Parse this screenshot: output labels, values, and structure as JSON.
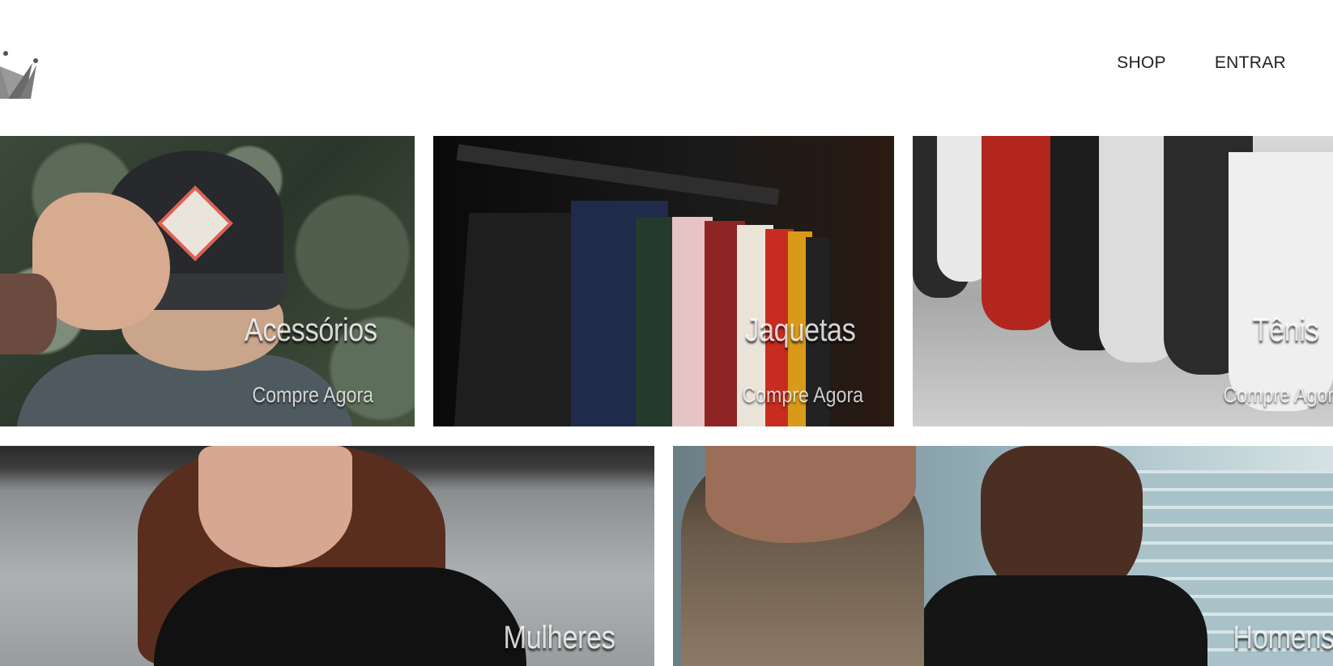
{
  "header": {
    "logo_icon": "crown-icon",
    "nav": [
      {
        "label": "SHOP"
      },
      {
        "label": "ENTRAR"
      }
    ]
  },
  "categories": [
    {
      "title": "Acessórios",
      "cta": "Compre Agora",
      "image": "cap-photo"
    },
    {
      "title": "Jaquetas",
      "cta": "Compre Agora",
      "image": "jackets-rack-photo"
    },
    {
      "title": "Tênis",
      "cta": "Compre Agora",
      "image": "sneakers-photo"
    },
    {
      "title": "Mulheres",
      "cta": "",
      "image": "woman-photo"
    },
    {
      "title": "Homens",
      "cta": "",
      "image": "man-photo"
    }
  ],
  "colors": {
    "background": "#ffffff",
    "nav_text": "#222222",
    "logo": "#6b6b6b"
  }
}
